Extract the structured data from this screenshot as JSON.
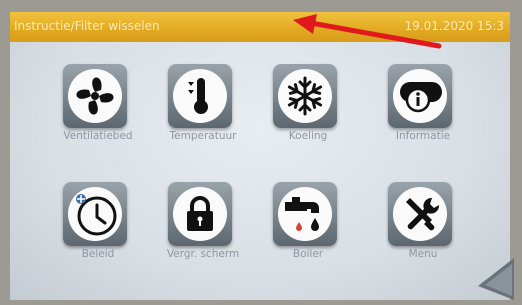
{
  "header": {
    "title": "Instructie/Filter wisselen",
    "datetime": "19.01.2020   15:3"
  },
  "menu": [
    {
      "label": "Ventilatiebed",
      "icon": "fan-icon"
    },
    {
      "label": "Temperatuur",
      "icon": "thermometer-icon"
    },
    {
      "label": "Koeling",
      "icon": "snowflake-icon"
    },
    {
      "label": "Informatie",
      "icon": "info-icon"
    },
    {
      "label": "Beleid",
      "icon": "clock-icon"
    },
    {
      "label": "Vergr. scherm",
      "icon": "padlock-icon"
    },
    {
      "label": "Boiler",
      "icon": "faucet-icon"
    },
    {
      "label": "Menu",
      "icon": "tools-icon"
    }
  ],
  "colors": {
    "title_bar": "#e2a921",
    "icon_frame": "#5c6770",
    "annotation_arrow": "#e0191c"
  }
}
